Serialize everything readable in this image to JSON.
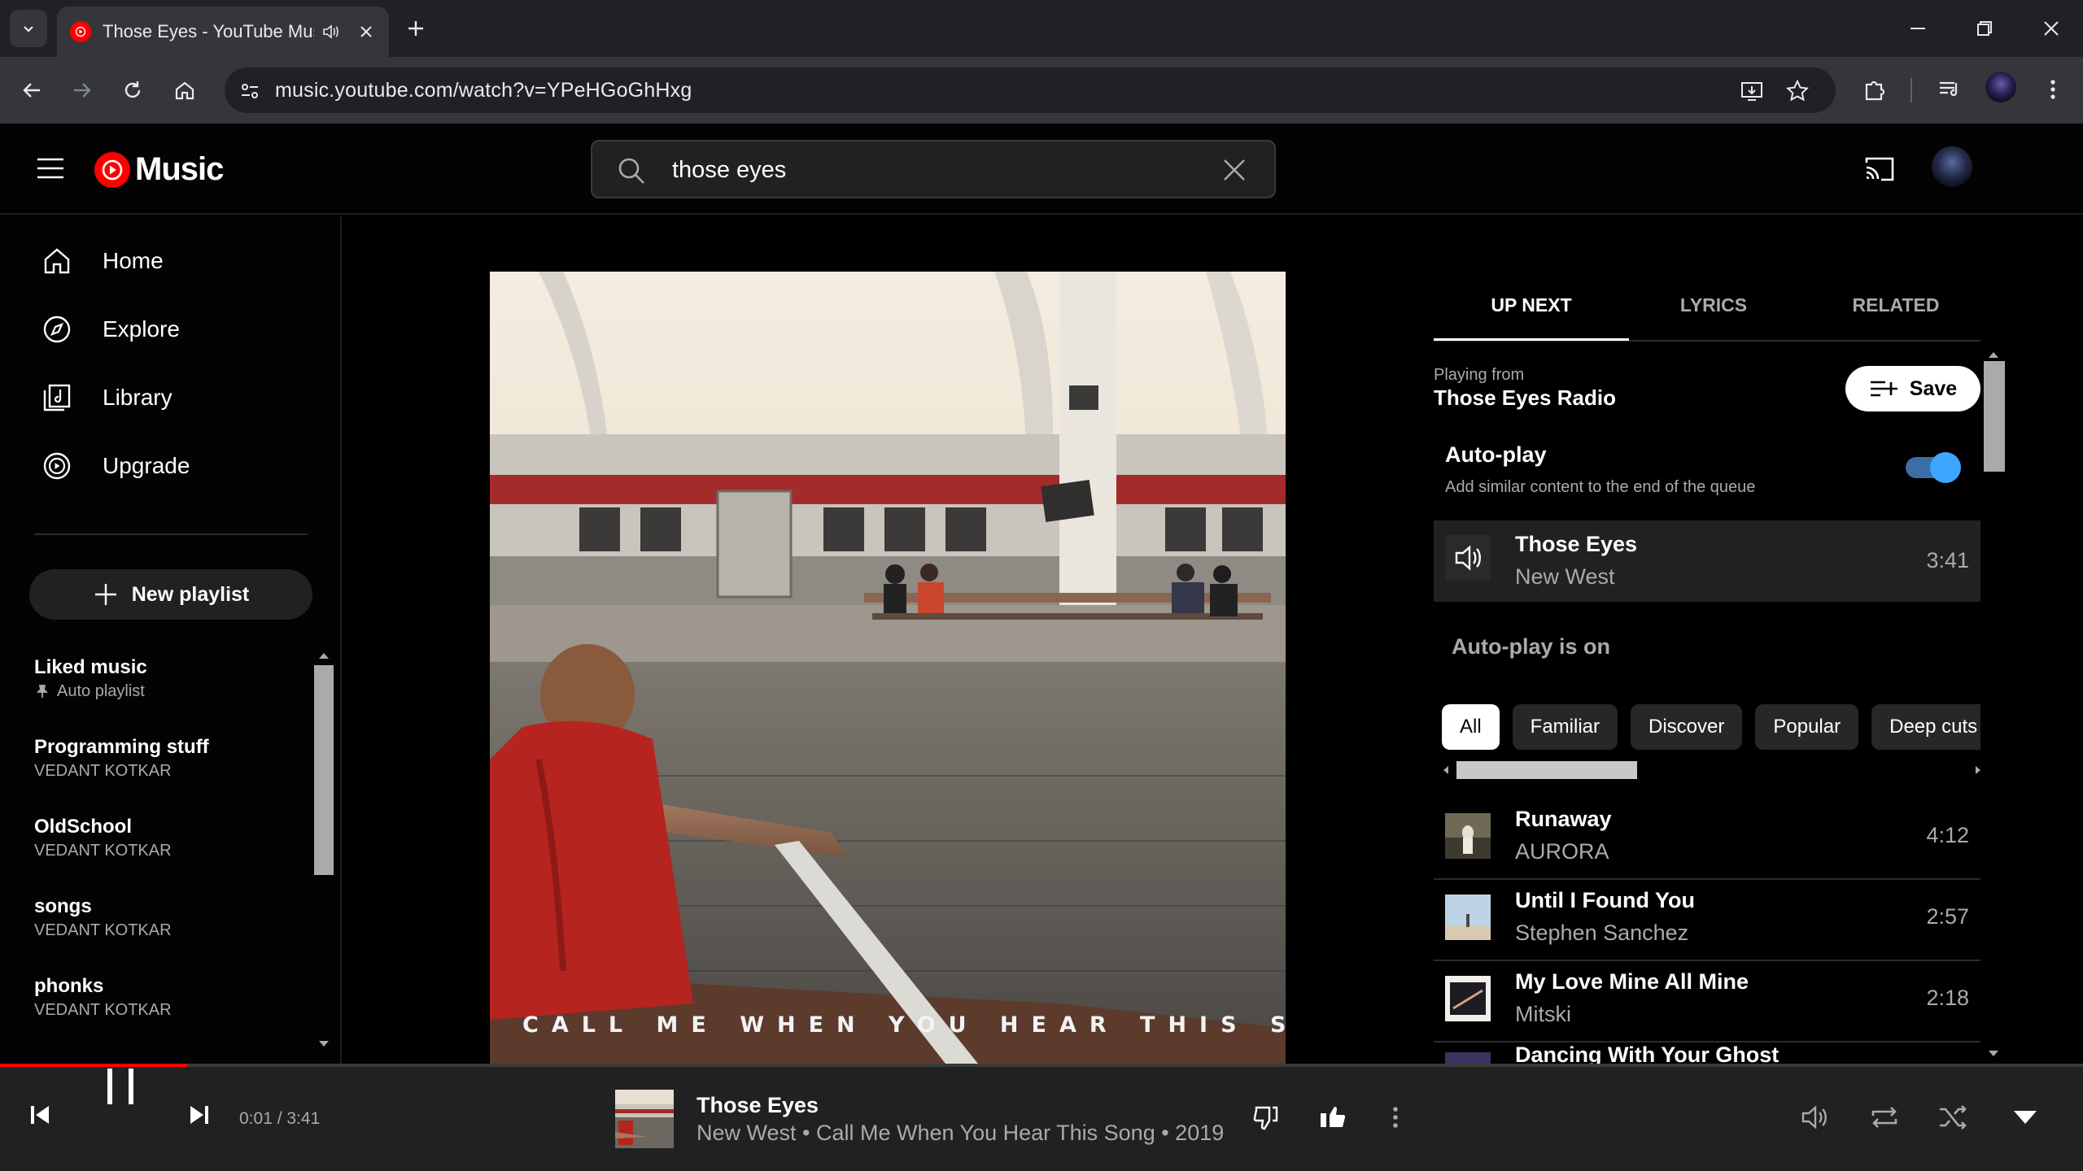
{
  "browser": {
    "tab_title": "Those Eyes - YouTube Music",
    "url": "music.youtube.com/watch?v=YPeHGoGhHxg"
  },
  "header": {
    "logo_text": "Music",
    "search_value": "those eyes"
  },
  "sidebar": {
    "nav": [
      {
        "label": "Home",
        "icon": "home-icon"
      },
      {
        "label": "Explore",
        "icon": "compass-icon"
      },
      {
        "label": "Library",
        "icon": "library-icon"
      },
      {
        "label": "Upgrade",
        "icon": "upgrade-icon"
      }
    ],
    "new_playlist_label": "New playlist",
    "playlists": [
      {
        "title": "Liked music",
        "subtitle": "Auto playlist"
      },
      {
        "title": "Programming stuff",
        "subtitle": "VEDANT KOTKAR"
      },
      {
        "title": "OldSchool",
        "subtitle": "VEDANT KOTKAR"
      },
      {
        "title": "songs",
        "subtitle": "VEDANT KOTKAR"
      },
      {
        "title": "phonks",
        "subtitle": "VEDANT KOTKAR"
      }
    ]
  },
  "artwork": {
    "caption": "CALL ME WHEN YOU HEAR THIS SONG"
  },
  "queue": {
    "tabs": [
      "UP NEXT",
      "LYRICS",
      "RELATED"
    ],
    "playing_from_label": "Playing from",
    "playlist_name": "Those Eyes Radio",
    "save_label": "Save",
    "autoplay_title": "Auto-play",
    "autoplay_sub": "Add similar content to the end of the queue",
    "autoplay_enabled": true,
    "current": {
      "title": "Those Eyes",
      "artist": "New West",
      "duration": "3:41"
    },
    "autoplay_on_label": "Auto-play is on",
    "chips": [
      "All",
      "Familiar",
      "Discover",
      "Popular",
      "Deep cuts"
    ],
    "items": [
      {
        "title": "Runaway",
        "artist": "AURORA",
        "duration": "4:12"
      },
      {
        "title": "Until I Found You",
        "artist": "Stephen Sanchez",
        "duration": "2:57"
      },
      {
        "title": "My Love Mine All Mine",
        "artist": "Mitski",
        "duration": "2:18"
      },
      {
        "title": "Dancing With Your Ghost",
        "artist": "",
        "duration": ""
      }
    ]
  },
  "player": {
    "time": "0:01 / 3:41",
    "progress_fraction": 0.005,
    "title": "Those Eyes",
    "subtitle": "New West • Call Me When You Hear This Song • 2019"
  },
  "colors": {
    "accent_red": "#ff0000",
    "toggle_blue": "#3ea6ff",
    "background": "#030303",
    "player_bg": "#212121"
  }
}
